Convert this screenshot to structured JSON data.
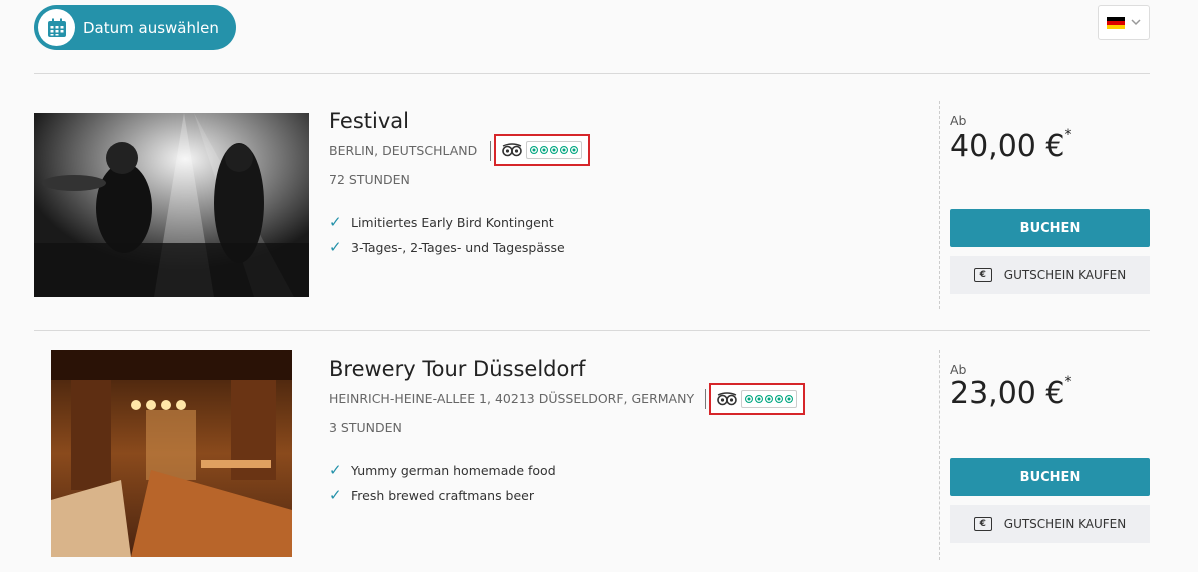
{
  "header": {
    "date_button_label": "Datum auswählen",
    "language": "Deutsch"
  },
  "icons": {
    "calendar": "calendar-icon",
    "flag": "german-flag-icon",
    "chevron": "chevron-down-icon",
    "check": "check-icon",
    "tripadvisor": "tripadvisor-owl-icon",
    "voucher": "euro-voucher-icon"
  },
  "colors": {
    "accent": "#2592aa",
    "highlight_border": "#d6262a",
    "rating_green": "#00a680"
  },
  "events": [
    {
      "title": "Festival",
      "location": "BERLIN, DEUTSCHLAND",
      "duration": "72 STUNDEN",
      "features": [
        "Limitiertes Early Bird Kontingent",
        "3-Tages-, 2-Tages- und Tagespässe"
      ],
      "rating_circles": 5,
      "price_prefix": "Ab",
      "price": "40,00 €",
      "price_note": "*",
      "book_label": "BUCHEN",
      "voucher_label": "GUTSCHEIN KAUFEN"
    },
    {
      "title": "Brewery Tour Düsseldorf",
      "location": "HEINRICH-HEINE-ALLEE 1, 40213 DÜSSELDORF, GERMANY",
      "duration": "3 STUNDEN",
      "features": [
        "Yummy german homemade food",
        "Fresh brewed craftmans beer"
      ],
      "rating_circles": 5,
      "price_prefix": "Ab",
      "price": "23,00 €",
      "price_note": "*",
      "book_label": "BUCHEN",
      "voucher_label": "GUTSCHEIN KAUFEN"
    }
  ]
}
